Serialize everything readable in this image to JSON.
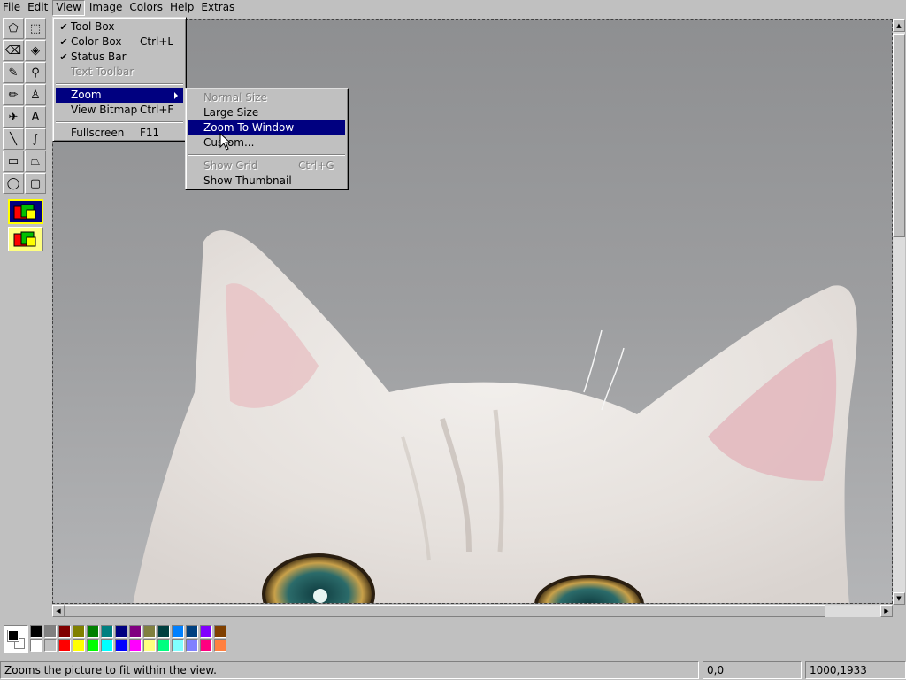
{
  "menubar": {
    "items": [
      {
        "label": "File"
      },
      {
        "label": "Edit"
      },
      {
        "label": "View"
      },
      {
        "label": "Image"
      },
      {
        "label": "Colors"
      },
      {
        "label": "Help"
      },
      {
        "label": "Extras"
      }
    ]
  },
  "view_menu": {
    "items": [
      {
        "label": "Tool Box",
        "shortcut": "",
        "checked": "✔"
      },
      {
        "label": "Color Box",
        "shortcut": "Ctrl+L",
        "checked": "✔"
      },
      {
        "label": "Status Bar",
        "shortcut": "",
        "checked": "✔"
      },
      {
        "label": "Text Toolbar",
        "shortcut": "",
        "checked": ""
      },
      {
        "label": "Zoom",
        "shortcut": "",
        "checked": ""
      },
      {
        "label": "View Bitmap",
        "shortcut": "Ctrl+F",
        "checked": ""
      },
      {
        "label": "Fullscreen",
        "shortcut": "F11",
        "checked": ""
      }
    ]
  },
  "zoom_menu": {
    "items": [
      {
        "label": "Normal Size",
        "shortcut": ""
      },
      {
        "label": "Large Size",
        "shortcut": ""
      },
      {
        "label": "Zoom To Window",
        "shortcut": ""
      },
      {
        "label": "Custom...",
        "shortcut": ""
      },
      {
        "label": "Show Grid",
        "shortcut": "Ctrl+G"
      },
      {
        "label": "Show Thumbnail",
        "shortcut": ""
      }
    ]
  },
  "toolbox": {
    "tools": [
      {
        "icon": "free-select-icon",
        "glyph": "⬠"
      },
      {
        "icon": "rect-select-icon",
        "glyph": "⬚"
      },
      {
        "icon": "eraser-icon",
        "glyph": "⌫"
      },
      {
        "icon": "fill-icon",
        "glyph": "◈"
      },
      {
        "icon": "color-picker-icon",
        "glyph": "✎"
      },
      {
        "icon": "magnifier-icon",
        "glyph": "⚲"
      },
      {
        "icon": "pencil-icon",
        "glyph": "✏"
      },
      {
        "icon": "brush-icon",
        "glyph": "♙"
      },
      {
        "icon": "airbrush-icon",
        "glyph": "✈"
      },
      {
        "icon": "text-icon",
        "glyph": "A"
      },
      {
        "icon": "line-icon",
        "glyph": "╲"
      },
      {
        "icon": "curve-icon",
        "glyph": "∫"
      },
      {
        "icon": "rectangle-icon",
        "glyph": "▭"
      },
      {
        "icon": "polygon-icon",
        "glyph": "⏢"
      },
      {
        "icon": "ellipse-icon",
        "glyph": "◯"
      },
      {
        "icon": "rounded-rect-icon",
        "glyph": "▢"
      }
    ]
  },
  "palette": {
    "top": [
      "#000000",
      "#808080",
      "#800000",
      "#808000",
      "#008000",
      "#008080",
      "#000080",
      "#800080",
      "#808040",
      "#004040",
      "#0080ff",
      "#004080",
      "#8000ff",
      "#804000"
    ],
    "bottom": [
      "#ffffff",
      "#c0c0c0",
      "#ff0000",
      "#ffff00",
      "#00ff00",
      "#00ffff",
      "#0000ff",
      "#ff00ff",
      "#ffff80",
      "#00ff80",
      "#80ffff",
      "#8080ff",
      "#ff0080",
      "#ff8040"
    ],
    "foreground": "#000000",
    "background": "#ffffff"
  },
  "statusbar": {
    "message": "Zooms the picture to fit within the view.",
    "cursor_pos": "0,0",
    "image_size": "1000,1933"
  }
}
